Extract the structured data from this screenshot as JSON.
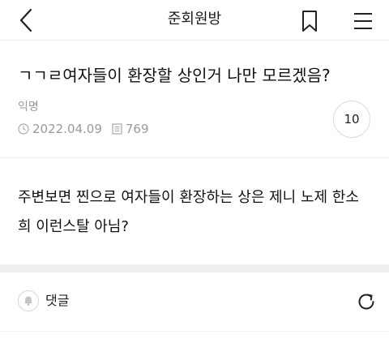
{
  "header": {
    "title": "준회원방",
    "back_icon": "chevron-left-icon",
    "bookmark_icon": "bookmark-icon",
    "menu_icon": "hamburger-menu-icon"
  },
  "post": {
    "title": "ㄱㄱㄹ여자들이 환장할 상인거 나만 모르겠음?",
    "author": "익명",
    "date": "2022.04.09",
    "views": "769",
    "comment_count": "10",
    "body_lines": [
      "주변보면 찐으로 여자들이 환장하는 상은 제니 노제 한소",
      "희 이런스탈 아님?"
    ]
  },
  "comments": {
    "label": "댓글",
    "bell_icon": "bell-icon",
    "refresh_icon": "refresh-icon"
  },
  "colors": {
    "text": "#111111",
    "muted": "#9a9a9a",
    "separator": "#eeeeee"
  }
}
